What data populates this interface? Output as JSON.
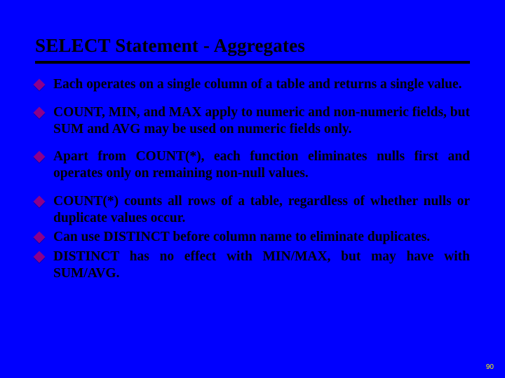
{
  "title": "SELECT Statement - Aggregates",
  "bullets": [
    "Each operates on a single column of a table and returns a single value.",
    "COUNT, MIN, and MAX apply to numeric and non-numeric fields, but SUM and AVG may be used on numeric fields only.",
    "Apart from COUNT(*), each function eliminates nulls first and operates only on remaining non-null values.",
    "COUNT(*) counts all rows of a table, regardless of whether nulls or duplicate values occur.",
    "Can use DISTINCT before column name to eliminate duplicates.",
    "DISTINCT has no effect with MIN/MAX, but may have with SUM/AVG."
  ],
  "page_number": "90"
}
